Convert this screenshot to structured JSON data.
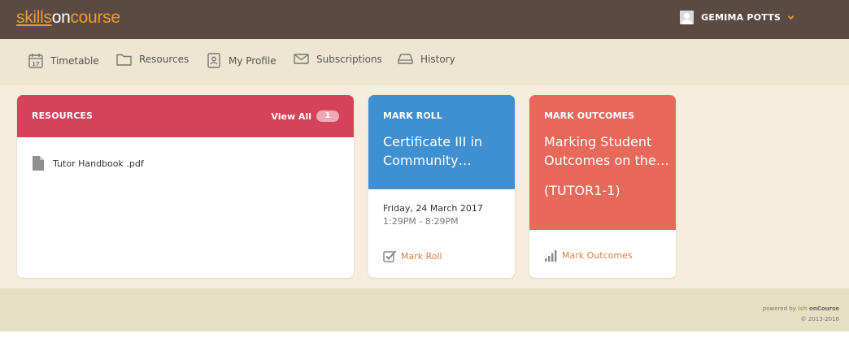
{
  "header": {
    "logo": {
      "word1": "skills",
      "word2": "on",
      "word3": "course"
    },
    "user_name": "GEMIMA POTTS"
  },
  "nav": {
    "items": [
      {
        "label": "Timetable",
        "icon": "calendar-icon"
      },
      {
        "label": "Resources",
        "icon": "folder-icon"
      },
      {
        "label": "My Profile",
        "icon": "profile-icon"
      },
      {
        "label": "Subscriptions",
        "icon": "envelope-icon"
      },
      {
        "label": "History",
        "icon": "inbox-tray-icon"
      }
    ]
  },
  "resources_card": {
    "title": "RESOURCES",
    "view_all": "View All",
    "count": "1",
    "files": [
      {
        "name": "Tutor Handbook .pdf",
        "icon": "document-icon"
      }
    ]
  },
  "mark_roll_card": {
    "title": "MARK ROLL",
    "course_line1": "Certificate III in",
    "course_line2": "Community…",
    "date": "Friday, 24 March 2017",
    "time": "1:29PM - 8:29PM",
    "action": "Mark Roll"
  },
  "mark_outcomes_card": {
    "title": "MARK OUTCOMES",
    "line1": "Marking Student",
    "line2": "Outcomes on the…",
    "code": "(TUTOR1-1)",
    "action": "Mark Outcomes"
  },
  "footer": {
    "powered_by": "powered by",
    "ish": "ish",
    "oncourse": "onCourse",
    "copyright": "© 2013-2016"
  },
  "colors": {
    "header_bg": "#5b4a41",
    "accent_orange": "#e89b35",
    "resources_red": "#d5435a",
    "roll_blue": "#3f8fd3",
    "outcomes_coral": "#e8695a",
    "link_orange": "#d9803f"
  }
}
